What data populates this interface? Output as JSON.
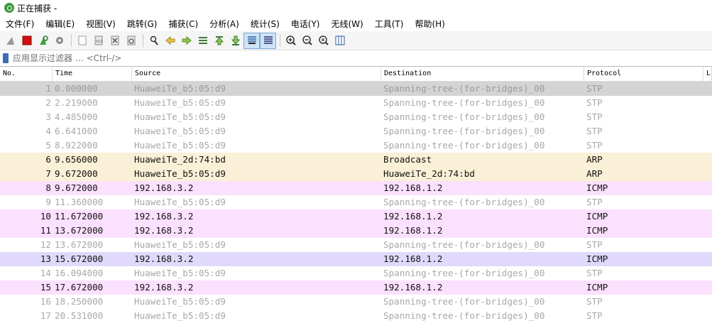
{
  "window": {
    "title": "正在捕获 -"
  },
  "menu": [
    "文件(F)",
    "编辑(E)",
    "视图(V)",
    "跳转(G)",
    "捕获(C)",
    "分析(A)",
    "统计(S)",
    "电话(Y)",
    "无线(W)",
    "工具(T)",
    "帮助(H)"
  ],
  "toolbar": {
    "icons": [
      "shark-fin-start-icon",
      "stop-square-icon",
      "restart-capture-icon",
      "capture-options-gear-icon",
      "open-file-icon",
      "save-file-icon",
      "close-file-icon",
      "reload-file-icon",
      "find-packet-icon",
      "go-back-arrow-icon",
      "go-forward-arrow-icon",
      "go-to-packet-icon",
      "first-packet-icon",
      "last-packet-icon",
      "autoscroll-icon",
      "colorize-icon",
      "zoom-in-icon",
      "zoom-out-icon",
      "normal-size-icon",
      "resize-columns-icon"
    ]
  },
  "filter": {
    "placeholder": "应用显示过滤器 … <Ctrl-/>"
  },
  "columns": [
    "No.",
    "Time",
    "Source",
    "Destination",
    "Protocol",
    "L"
  ],
  "rows": [
    {
      "no": "1",
      "time": "0.000000",
      "src": "HuaweiTe_b5:05:d9",
      "dst": "Spanning-tree-(for-bridges)_00",
      "proto": "STP",
      "kind": "stp",
      "selected": true
    },
    {
      "no": "2",
      "time": "2.219000",
      "src": "HuaweiTe_b5:05:d9",
      "dst": "Spanning-tree-(for-bridges)_00",
      "proto": "STP",
      "kind": "stp"
    },
    {
      "no": "3",
      "time": "4.485000",
      "src": "HuaweiTe_b5:05:d9",
      "dst": "Spanning-tree-(for-bridges)_00",
      "proto": "STP",
      "kind": "stp"
    },
    {
      "no": "4",
      "time": "6.641000",
      "src": "HuaweiTe_b5:05:d9",
      "dst": "Spanning-tree-(for-bridges)_00",
      "proto": "STP",
      "kind": "stp"
    },
    {
      "no": "5",
      "time": "8.922000",
      "src": "HuaweiTe_b5:05:d9",
      "dst": "Spanning-tree-(for-bridges)_00",
      "proto": "STP",
      "kind": "stp"
    },
    {
      "no": "6",
      "time": "9.656000",
      "src": "HuaweiTe_2d:74:bd",
      "dst": "Broadcast",
      "proto": "ARP",
      "kind": "arp"
    },
    {
      "no": "7",
      "time": "9.672000",
      "src": "HuaweiTe_b5:05:d9",
      "dst": "HuaweiTe_2d:74:bd",
      "proto": "ARP",
      "kind": "arp"
    },
    {
      "no": "8",
      "time": "9.672000",
      "src": "192.168.3.2",
      "dst": "192.168.1.2",
      "proto": "ICMP",
      "kind": "icmp"
    },
    {
      "no": "9",
      "time": "11.360000",
      "src": "HuaweiTe_b5:05:d9",
      "dst": "Spanning-tree-(for-bridges)_00",
      "proto": "STP",
      "kind": "stp"
    },
    {
      "no": "10",
      "time": "11.672000",
      "src": "192.168.3.2",
      "dst": "192.168.1.2",
      "proto": "ICMP",
      "kind": "icmp"
    },
    {
      "no": "11",
      "time": "13.672000",
      "src": "192.168.3.2",
      "dst": "192.168.1.2",
      "proto": "ICMP",
      "kind": "icmp"
    },
    {
      "no": "12",
      "time": "13.672000",
      "src": "HuaweiTe_b5:05:d9",
      "dst": "Spanning-tree-(for-bridges)_00",
      "proto": "STP",
      "kind": "stp"
    },
    {
      "no": "13",
      "time": "15.672000",
      "src": "192.168.3.2",
      "dst": "192.168.1.2",
      "proto": "ICMP",
      "kind": "icmp",
      "marked": true
    },
    {
      "no": "14",
      "time": "16.094000",
      "src": "HuaweiTe_b5:05:d9",
      "dst": "Spanning-tree-(for-bridges)_00",
      "proto": "STP",
      "kind": "stp"
    },
    {
      "no": "15",
      "time": "17.672000",
      "src": "192.168.3.2",
      "dst": "192.168.1.2",
      "proto": "ICMP",
      "kind": "icmp"
    },
    {
      "no": "16",
      "time": "18.250000",
      "src": "HuaweiTe_b5:05:d9",
      "dst": "Spanning-tree-(for-bridges)_00",
      "proto": "STP",
      "kind": "stp"
    },
    {
      "no": "17",
      "time": "20.531000",
      "src": "HuaweiTe_b5:05:d9",
      "dst": "Spanning-tree-(for-bridges)_00",
      "proto": "STP",
      "kind": "stp"
    }
  ]
}
